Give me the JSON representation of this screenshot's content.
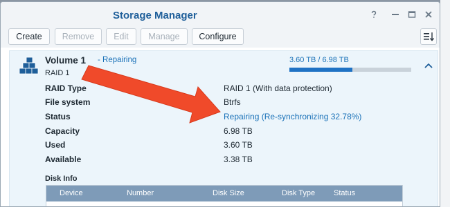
{
  "window": {
    "title": "Storage Manager",
    "controls": [
      "help-icon",
      "minimize-icon",
      "maximize-icon",
      "close-icon"
    ]
  },
  "toolbar": {
    "buttons": [
      {
        "label": "Create",
        "enabled": true
      },
      {
        "label": "Remove",
        "enabled": false
      },
      {
        "label": "Edit",
        "enabled": false
      },
      {
        "label": "Manage",
        "enabled": false
      },
      {
        "label": "Configure",
        "enabled": true
      }
    ],
    "sort_icon": "sort-icon"
  },
  "volume": {
    "name": "Volume 1",
    "status": "Repairing",
    "raid": "RAID 1",
    "usage_text": "3.60 TB / 6.98 TB",
    "usage_fraction": 0.516,
    "icon": "volume-stack-icon",
    "collapse_icon": "chevron-up-icon"
  },
  "details": [
    {
      "label": "RAID Type",
      "value": "RAID 1 (With data protection)",
      "link": false
    },
    {
      "label": "File system",
      "value": "Btrfs",
      "link": false
    },
    {
      "label": "Status",
      "value": "Repairing (Re-synchronizing 32.78%)",
      "link": true
    },
    {
      "label": "Capacity",
      "value": "6.98 TB",
      "link": false
    },
    {
      "label": "Used",
      "value": "3.60 TB",
      "link": false
    },
    {
      "label": "Available",
      "value": "3.38 TB",
      "link": false
    }
  ],
  "disk_info": {
    "title": "Disk Info",
    "columns": [
      "Device",
      "Number",
      "Disk Size",
      "Disk Type",
      "Status"
    ]
  },
  "colors": {
    "accent": "#1b72b8",
    "annotation_arrow": "#f04a2a",
    "panel_bg": "#ecf5fb",
    "table_header": "#7e9bb8"
  }
}
